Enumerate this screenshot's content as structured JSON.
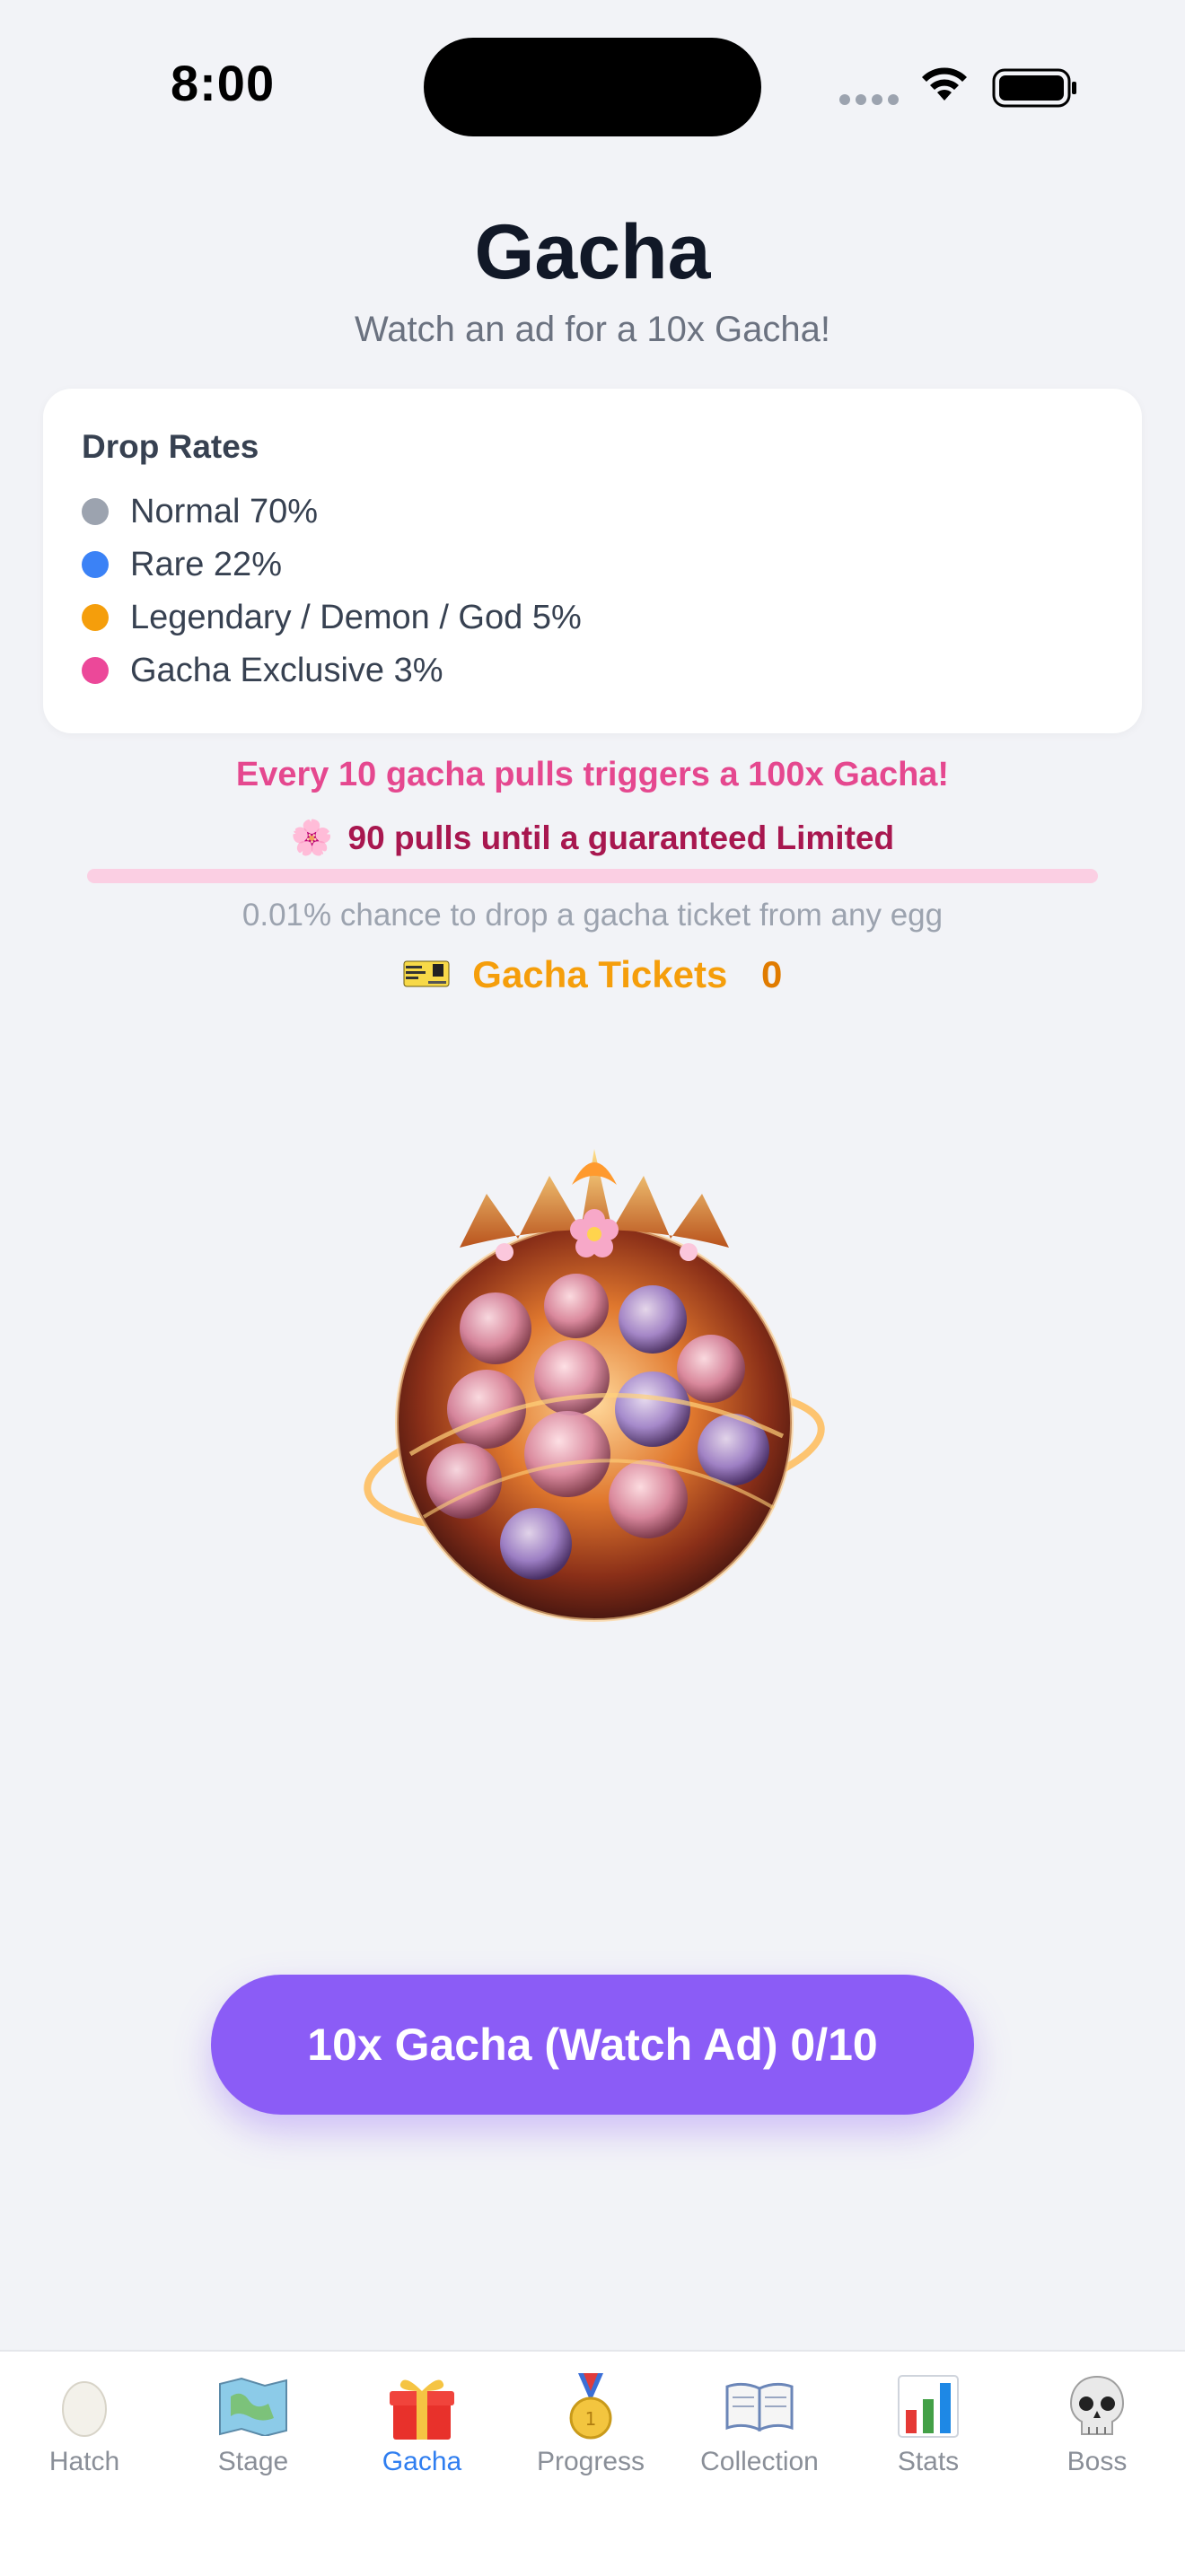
{
  "status_bar": {
    "time": "8:00"
  },
  "header": {
    "title": "Gacha",
    "subtitle": "Watch an ad for a 10x Gacha!"
  },
  "drop_rates": {
    "title": "Drop Rates",
    "items": [
      {
        "label": "Normal 70%",
        "color": "#9ca3af"
      },
      {
        "label": "Rare 22%",
        "color": "#3b82f6"
      },
      {
        "label": "Legendary / Demon / God 5%",
        "color": "#f59e0b"
      },
      {
        "label": "Gacha Exclusive 3%",
        "color": "#ec4899"
      }
    ]
  },
  "promo": "Every 10 gacha pulls triggers a 100x Gacha!",
  "guarantee": {
    "icon": "cherry-blossom-icon",
    "text": "90 pulls until a guaranteed Limited"
  },
  "guarantee_progress": 0.0,
  "chance_note": "0.01% chance to drop a gacha ticket from any egg",
  "tickets": {
    "icon": "ticket-icon",
    "label": "Gacha Tickets",
    "count": "0"
  },
  "cta_label": "10x Gacha (Watch Ad) 0/10",
  "tabs": [
    {
      "label": "Hatch",
      "icon": "egg-icon",
      "active": false
    },
    {
      "label": "Stage",
      "icon": "map-icon",
      "active": false
    },
    {
      "label": "Gacha",
      "icon": "gift-icon",
      "active": true
    },
    {
      "label": "Progress",
      "icon": "medal-icon",
      "active": false
    },
    {
      "label": "Collection",
      "icon": "book-icon",
      "active": false
    },
    {
      "label": "Stats",
      "icon": "bar-chart-icon",
      "active": false
    },
    {
      "label": "Boss",
      "icon": "skull-icon",
      "active": false
    }
  ],
  "colors": {
    "accent": "#8b5cf6",
    "pink": "#e5488f",
    "gold": "#f59e0b",
    "tab_active": "#2f7ef0"
  }
}
